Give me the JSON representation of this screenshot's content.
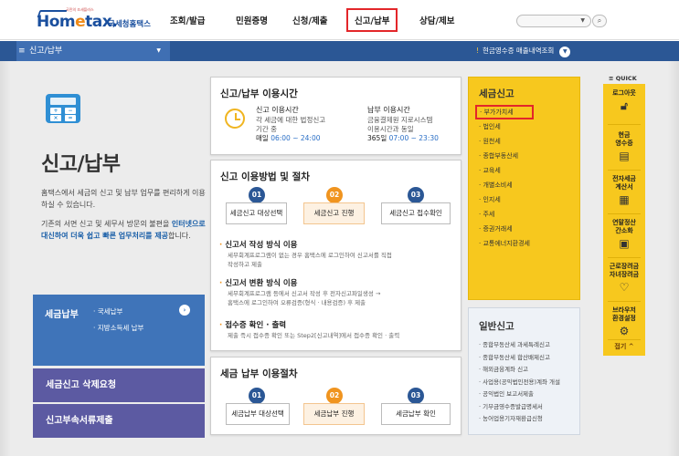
{
  "header": {
    "logo_small": "국민의 조세플러스",
    "logo_main": "Hom",
    "logo_e": "e",
    "logo_tail": "tax.",
    "logo_sub": "국세청홈택스",
    "nav": [
      "조회/발급",
      "민원증명",
      "신청/제출",
      "신고/납부",
      "상담/제보"
    ],
    "selected_nav": "신고/납부",
    "search_placeholder": "",
    "search_icon": "search-icon"
  },
  "bar": {
    "menu_icon": "≡",
    "menu_label": "신고/납부",
    "notice_mark": "!",
    "notice_text": "현금영수증 매출내역조회"
  },
  "left": {
    "title": "신고/납부",
    "desc1": "홈택스에서 세금의 신고 및 납부 업무를 편리하게 이용하실 수 있습니다.",
    "desc2_a": "기존의 서면 신고 및 세무서 방문의 불편을 ",
    "desc2_b": "인터넷으로 대신하여 더욱 쉽고 빠른 업무처리를 제공",
    "desc2_c": "합니다.",
    "nav_title": "세금납부",
    "nav_items": [
      "· 국세납부",
      "· 지방소득세 납부"
    ],
    "btn_delete": "세금신고 삭제요청",
    "btn_attach": "신고부속서류제출"
  },
  "hours": {
    "title": "신고/납부 이용시간",
    "filing_head": "신고 이용시간",
    "filing_l1": "각 세금에 대한 법정신고",
    "filing_l2": "기간 중",
    "filing_day": "매일",
    "filing_time": "06:00 ~ 24:00",
    "pay_head": "납부 이용시간",
    "pay_l1": "금융결제원 지로시스템",
    "pay_l2": "이용시간과 동일",
    "pay_day": "365일",
    "pay_time": "07:00 ~ 23:30"
  },
  "howto": {
    "title": "신고 이용방법 및 절차",
    "steps": [
      "세금신고 대상선택",
      "세금신고 진행",
      "세금신고 접수확인"
    ],
    "nums": [
      "01",
      "02",
      "03"
    ],
    "b1_head": "신고서 작성 방식 이용",
    "b1_l1": "세무회계프로그램이 없는 경우 홈택스에 로그인하여 신고서를 직접",
    "b1_l2": "작성하고 제출",
    "b2_head": "신고서 변환 방식 이용",
    "b2_l1": "세무회계프로그램 등에서 신고서 작성 후 전자신고파일생성 →",
    "b2_l2": "홈택스에 로그인하여 오류검증(형식 · 내용검증) 후 제출",
    "b3_head": "접수증 확인 · 출력",
    "b3_l1": "제출 즉시 접수증 확인 또는 Step2[신고내역]에서 접수증 확인 · 출력"
  },
  "payproc": {
    "title": "세금 납부 이용절차",
    "steps": [
      "세금납부 대상선택",
      "세금납부 진행",
      "세금납부 확인"
    ],
    "nums": [
      "01",
      "02",
      "03"
    ]
  },
  "tax_filing": {
    "title": "세금신고",
    "items": [
      "· 부가가치세",
      "· 법인세",
      "· 원천세",
      "· 종합부동산세",
      "· 교육세",
      "· 개별소비세",
      "· 인지세",
      "· 주세",
      "· 증권거래세",
      "· 교통에너지환경세"
    ],
    "selected": "· 부가가치세"
  },
  "general": {
    "title": "일반신고",
    "items": [
      "· 종합부동산세 과세특례신고",
      "· 종합부동산세 합산배제신고",
      "· 해외금융계좌 신고",
      "· 사업용(공익법인전용)계좌 개설",
      "· 공익법인 보고서제출",
      "· 기부금영수증발급명세서",
      "· 농어업용기자재환급신청"
    ]
  },
  "quick": {
    "header": "≡ QUICK",
    "items": [
      {
        "l1": "로그아웃",
        "l2": "",
        "icon": "lock-icon"
      },
      {
        "l1": "현금",
        "l2": "영수증",
        "icon": "receipt-icon"
      },
      {
        "l1": "전자세금",
        "l2": "계산서",
        "icon": "invoice-icon"
      },
      {
        "l1": "연말정산",
        "l2": "간소화",
        "icon": "document-icon"
      },
      {
        "l1": "근로장려금",
        "l2": "자녀장려금",
        "icon": "heart-icon"
      },
      {
        "l1": "브라우저",
        "l2": "환경설정",
        "icon": "gear-icon"
      }
    ],
    "close": "접기 ^"
  }
}
